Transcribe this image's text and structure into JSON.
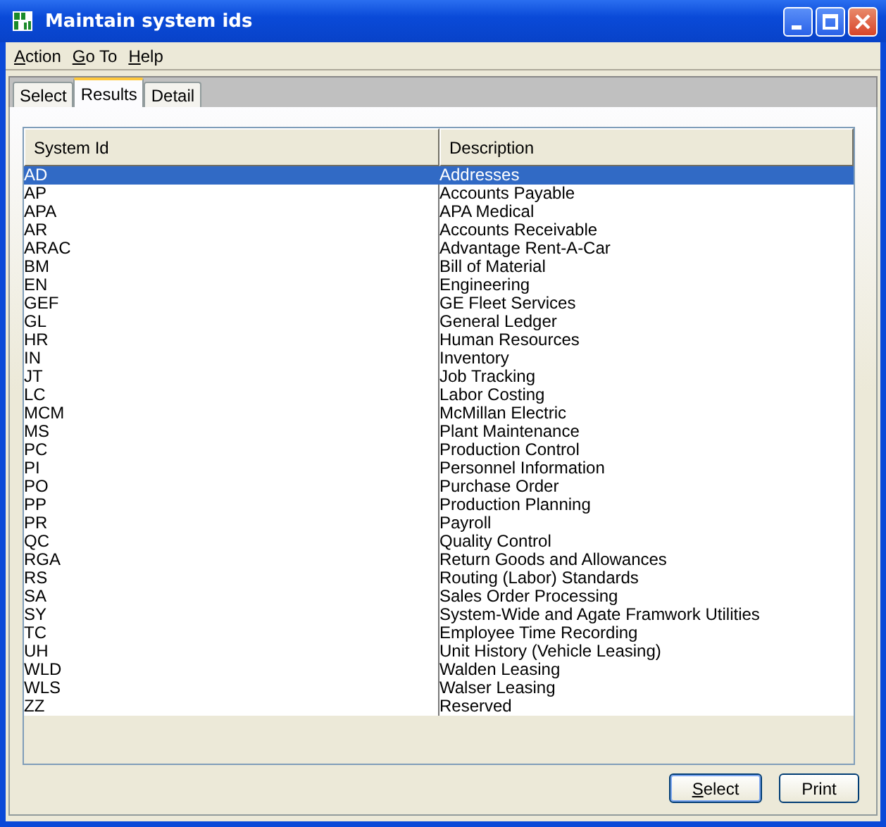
{
  "window": {
    "title": "Maintain system ids"
  },
  "menu": [
    {
      "label": "Action",
      "mnemonic_underlined": true
    },
    {
      "label": "Go To",
      "mnemonic_underlined": true
    },
    {
      "label": "Help",
      "mnemonic_underlined": true
    }
  ],
  "tabs": [
    {
      "label": "Select",
      "selected": false
    },
    {
      "label": "Results",
      "selected": true
    },
    {
      "label": "Detail",
      "selected": false
    }
  ],
  "table": {
    "columns": [
      "System Id",
      "Description"
    ],
    "rows": [
      {
        "id": "AD",
        "description": "Addresses",
        "selected": true
      },
      {
        "id": "AP",
        "description": "Accounts Payable",
        "selected": false
      },
      {
        "id": "APA",
        "description": "APA Medical",
        "selected": false
      },
      {
        "id": "AR",
        "description": "Accounts Receivable",
        "selected": false
      },
      {
        "id": "ARAC",
        "description": "Advantage Rent-A-Car",
        "selected": false
      },
      {
        "id": "BM",
        "description": "Bill of Material",
        "selected": false
      },
      {
        "id": "EN",
        "description": "Engineering",
        "selected": false
      },
      {
        "id": "GEF",
        "description": "GE Fleet Services",
        "selected": false
      },
      {
        "id": "GL",
        "description": "General Ledger",
        "selected": false
      },
      {
        "id": "HR",
        "description": "Human Resources",
        "selected": false
      },
      {
        "id": "IN",
        "description": "Inventory",
        "selected": false
      },
      {
        "id": "JT",
        "description": "Job Tracking",
        "selected": false
      },
      {
        "id": "LC",
        "description": "Labor Costing",
        "selected": false
      },
      {
        "id": "MCM",
        "description": "McMillan Electric",
        "selected": false
      },
      {
        "id": "MS",
        "description": "Plant Maintenance",
        "selected": false
      },
      {
        "id": "PC",
        "description": "Production Control",
        "selected": false
      },
      {
        "id": "PI",
        "description": "Personnel Information",
        "selected": false
      },
      {
        "id": "PO",
        "description": "Purchase Order",
        "selected": false
      },
      {
        "id": "PP",
        "description": "Production Planning",
        "selected": false
      },
      {
        "id": "PR",
        "description": "Payroll",
        "selected": false
      },
      {
        "id": "QC",
        "description": "Quality Control",
        "selected": false
      },
      {
        "id": "RGA",
        "description": "Return Goods and Allowances",
        "selected": false
      },
      {
        "id": "RS",
        "description": "Routing (Labor) Standards",
        "selected": false
      },
      {
        "id": "SA",
        "description": "Sales Order Processing",
        "selected": false
      },
      {
        "id": "SY",
        "description": "System-Wide and Agate Framwork Utilities",
        "selected": false
      },
      {
        "id": "TC",
        "description": "Employee Time Recording",
        "selected": false
      },
      {
        "id": "UH",
        "description": "Unit History (Vehicle Leasing)",
        "selected": false
      },
      {
        "id": "WLD",
        "description": "Walden Leasing",
        "selected": false
      },
      {
        "id": "WLS",
        "description": "Walser Leasing",
        "selected": false
      },
      {
        "id": "ZZ",
        "description": "Reserved",
        "selected": false
      }
    ]
  },
  "buttons": [
    {
      "label": "Select",
      "default": true,
      "mnemonic_underlined": true
    },
    {
      "label": "Print",
      "default": false,
      "mnemonic_underlined": false
    }
  ]
}
